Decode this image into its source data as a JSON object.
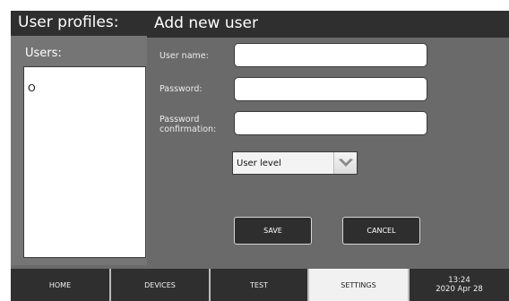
{
  "left_panel": {
    "title": "User profiles:",
    "users_label": "Users:",
    "users": [
      "O"
    ]
  },
  "form": {
    "title": "Add new user",
    "username_label": "User name:",
    "username_value": "",
    "password_label": "Password:",
    "password_value": "",
    "confirm_label_line1": "Password",
    "confirm_label_line2": "confirmation:",
    "confirm_value": "",
    "user_level_selected": "User level",
    "save_label": "SAVE",
    "cancel_label": "CANCEL"
  },
  "nav": {
    "tabs": [
      {
        "label": "HOME",
        "active": false
      },
      {
        "label": "DEVICES",
        "active": false
      },
      {
        "label": "TEST",
        "active": false
      },
      {
        "label": "SETTINGS",
        "active": true
      }
    ],
    "time": "13:24",
    "date": "2020 Apr 28"
  },
  "colors": {
    "panel_dark": "#2f2f2f",
    "panel_gray": "#6a6a6a",
    "active_tab": "#f1f1f1"
  },
  "icons": {
    "select_arrow": "chevron-down-icon"
  }
}
